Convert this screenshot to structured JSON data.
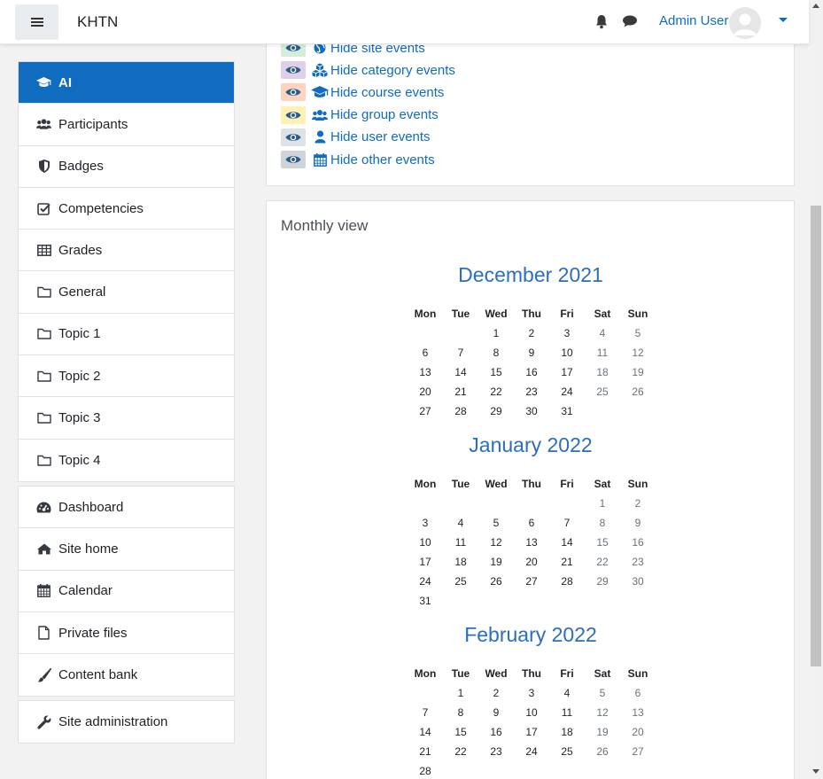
{
  "navbar": {
    "site_name": "KHTN",
    "user_name": "Admin User",
    "icons": [
      "hamburger-icon",
      "bell-icon",
      "message-icon",
      "avatar",
      "caret-down-icon"
    ]
  },
  "sidebar": {
    "course_items": [
      {
        "label": "AI",
        "icon": "graduation-cap-icon",
        "active": true
      },
      {
        "label": "Participants",
        "icon": "users-icon"
      },
      {
        "label": "Badges",
        "icon": "shield-icon"
      },
      {
        "label": "Competencies",
        "icon": "check-square-icon"
      },
      {
        "label": "Grades",
        "icon": "table-icon"
      },
      {
        "label": "General",
        "icon": "folder-icon"
      },
      {
        "label": "Topic 1",
        "icon": "folder-icon"
      },
      {
        "label": "Topic 2",
        "icon": "folder-icon"
      },
      {
        "label": "Topic 3",
        "icon": "folder-icon"
      },
      {
        "label": "Topic 4",
        "icon": "folder-icon"
      }
    ],
    "site_items": [
      {
        "label": "Dashboard",
        "icon": "dashboard-icon"
      },
      {
        "label": "Site home",
        "icon": "home-icon"
      },
      {
        "label": "Calendar",
        "icon": "calendar-icon"
      },
      {
        "label": "Private files",
        "icon": "file-icon"
      },
      {
        "label": "Content bank",
        "icon": "brush-icon"
      }
    ],
    "admin_items": [
      {
        "label": "Site administration",
        "icon": "wrench-icon"
      }
    ]
  },
  "event_filters": [
    {
      "label": "Hide site events",
      "icon": "globe-icon",
      "color": "#d4edda"
    },
    {
      "label": "Hide category events",
      "icon": "cubes-icon",
      "color": "#e0cfe9"
    },
    {
      "label": "Hide course events",
      "icon": "graduation-cap-icon",
      "color": "#ffd3bd"
    },
    {
      "label": "Hide group events",
      "icon": "users-icon",
      "color": "#fff0b3"
    },
    {
      "label": "Hide user events",
      "icon": "user-icon",
      "color": "#dee2e6"
    },
    {
      "label": "Hide other events",
      "icon": "calendar-icon",
      "color": "#ced4da"
    }
  ],
  "monthly_view": {
    "title": "Monthly view",
    "weekdays": [
      "Mon",
      "Tue",
      "Wed",
      "Thu",
      "Fri",
      "Sat",
      "Sun"
    ],
    "months": [
      {
        "name": "December 2021",
        "weeks": [
          [
            "",
            "",
            "1",
            "2",
            "3",
            "4",
            "5"
          ],
          [
            "6",
            "7",
            "8",
            "9",
            "10",
            "11",
            "12"
          ],
          [
            "13",
            "14",
            "15",
            "16",
            "17",
            "18",
            "19"
          ],
          [
            "20",
            "21",
            "22",
            "23",
            "24",
            "25",
            "26"
          ],
          [
            "27",
            "28",
            "29",
            "30",
            "31",
            "",
            ""
          ]
        ]
      },
      {
        "name": "January 2022",
        "weeks": [
          [
            "",
            "",
            "",
            "",
            "",
            "1",
            "2"
          ],
          [
            "3",
            "4",
            "5",
            "6",
            "7",
            "8",
            "9"
          ],
          [
            "10",
            "11",
            "12",
            "13",
            "14",
            "15",
            "16"
          ],
          [
            "17",
            "18",
            "19",
            "20",
            "21",
            "22",
            "23"
          ],
          [
            "24",
            "25",
            "26",
            "27",
            "28",
            "29",
            "30"
          ],
          [
            "31",
            "",
            "",
            "",
            "",
            "",
            ""
          ]
        ]
      },
      {
        "name": "February 2022",
        "weeks": [
          [
            "",
            "1",
            "2",
            "3",
            "4",
            "5",
            "6"
          ],
          [
            "7",
            "8",
            "9",
            "10",
            "11",
            "12",
            "13"
          ],
          [
            "14",
            "15",
            "16",
            "17",
            "18",
            "19",
            "20"
          ],
          [
            "21",
            "22",
            "23",
            "24",
            "25",
            "26",
            "27"
          ],
          [
            "28",
            "",
            "",
            "",
            "",
            "",
            ""
          ]
        ]
      }
    ]
  }
}
